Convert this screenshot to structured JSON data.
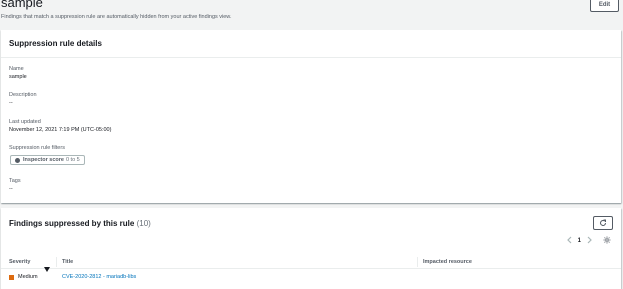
{
  "header": {
    "title": "sample",
    "subtitle": "Findings that match a suppression rule are automatically hidden from your active findings view.",
    "edit_label": "Edit"
  },
  "details": {
    "title": "Suppression rule details",
    "name_label": "Name",
    "name_value": "sample",
    "description_label": "Description",
    "description_value": "--",
    "updated_label": "Last updated",
    "updated_value": "November 12, 2021 7:19 PM (UTC-05:00)",
    "filters_label": "Suppression rule filters",
    "filter": {
      "key": "Inspector score",
      "value": "0 to 5"
    },
    "tags_label": "Tags",
    "tags_value": "--"
  },
  "findings": {
    "title": "Findings suppressed by this rule",
    "count": "(10)",
    "page": "1",
    "icons": {
      "refresh": "refresh-icon",
      "settings": "gear-icon",
      "prev": "chevron-left-icon",
      "next": "chevron-right-icon",
      "sort": "sort-down-icon"
    },
    "columns": {
      "severity": "Severity",
      "title": "Title",
      "resource": "Impacted resource"
    },
    "rows": [
      {
        "severity": "Medium",
        "severity_color": "#dd6b10",
        "title": "CVE-2020-2812 - mariadb-libs",
        "resource": ""
      }
    ]
  }
}
